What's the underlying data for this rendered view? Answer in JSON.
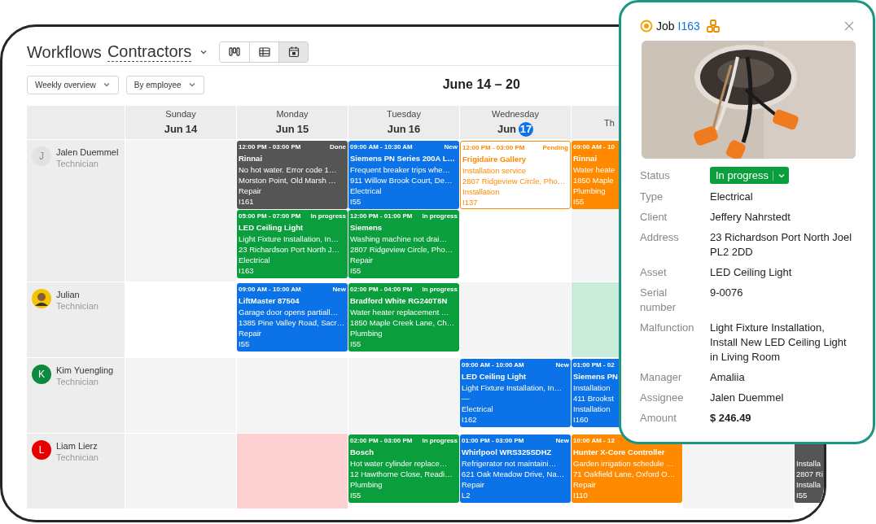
{
  "header": {
    "title": "Workflows",
    "workflow": "Contractors"
  },
  "views": [
    {
      "kind": "board",
      "selected": false
    },
    {
      "kind": "table",
      "selected": false
    },
    {
      "kind": "calendar",
      "selected": true
    }
  ],
  "filters": [
    {
      "label": "Weekly overview"
    },
    {
      "label": "By employee"
    }
  ],
  "period": "June 14 – 20",
  "days": [
    {
      "weekday": "Sunday",
      "month": "Jun",
      "day": "14",
      "today": false
    },
    {
      "weekday": "Monday",
      "month": "Jun",
      "day": "15",
      "today": false
    },
    {
      "weekday": "Tuesday",
      "month": "Jun",
      "day": "16",
      "today": false
    },
    {
      "weekday": "Wednesday",
      "month": "Jun",
      "day": "17",
      "today": true
    },
    {
      "weekday": "Th"
    }
  ],
  "rows": [
    {
      "name": "Jalen Duemmel",
      "role": "Technician",
      "avatar": {
        "kind": "letter",
        "initial": "J",
        "color": "#e2e2e2"
      },
      "cells": [
        {
          "color": "#f3f4f3"
        },
        {
          "events": [
            {
              "kind": "filled",
              "color": "#555555",
              "time": "12:00 PM - 03:00 PM",
              "status": "Done",
              "title": "Rinnai",
              "lines": [
                "No hot water. Error code 1…",
                "Morston Point, Old Marsh …",
                "Repair",
                "I161"
              ]
            },
            {
              "kind": "filled",
              "color": "#0a9e3c",
              "time": "05:00 PM - 07:00 PM",
              "status": "In progress",
              "title": "LED Ceiling Light",
              "lines": [
                "Light Fixture Installation, In…",
                "23 Richardson Port North J…",
                "Electrical",
                "I163"
              ]
            }
          ]
        },
        {
          "events": [
            {
              "kind": "filled",
              "color": "#0b72e7",
              "time": "09:00 AM - 10:30 AM",
              "status": "New",
              "title": "Siemens PN Series 200A L…",
              "lines": [
                "Frequent breaker trips whe…",
                "911 Willow Brook Court, De…",
                "Electrical",
                "I55"
              ]
            },
            {
              "kind": "filled",
              "color": "#0a9e3c",
              "time": "12:00 PM - 01:00 PM",
              "status": "In progress",
              "title": "Siemens",
              "lines": [
                "Washing machine not drai…",
                "2807 Ridgeview Circle, Pho…",
                "Repair",
                "I55"
              ]
            }
          ]
        },
        {
          "events": [
            {
              "kind": "outlined",
              "color": "#ff8a00",
              "time": "12:00 PM - 03:00 PM",
              "status": "Pending",
              "title": "Frigidaire Gallery",
              "lines": [
                "Installation service",
                "2807 Ridgeview Circle, Pho…",
                "Installation",
                "I137"
              ]
            }
          ]
        },
        {
          "color": "#f3f4f3",
          "events": [
            {
              "kind": "filled",
              "color": "#ff8a00",
              "time": "09:00 AM - 10",
              "title": "Rinnai",
              "lines": [
                "Water heate",
                "1850 Maple",
                "Plumbing",
                "I55"
              ]
            }
          ]
        }
      ]
    },
    {
      "name": "Julian",
      "role": "Technician",
      "cells": [
        {},
        {
          "events": [
            {
              "kind": "filled",
              "color": "#0b72e7",
              "time": "09:00 AM - 10:00 AM",
              "status": "New",
              "title": "LiftMaster 87504",
              "lines": [
                "Garage door opens partiall…",
                "1385 Pine Valley Road, Sacr…",
                "Repair",
                "I55"
              ]
            }
          ]
        },
        {
          "events": [
            {
              "kind": "filled",
              "color": "#0a9e3c",
              "time": "02:00 PM - 04:00 PM",
              "status": "In progress",
              "title": "Bradford White RG240T6N",
              "lines": [
                "Water heater replacement …",
                "1850 Maple Creek Lane, Ch…",
                "Plumbing",
                "I55"
              ]
            }
          ]
        },
        {
          "color": "#f3f4f3"
        },
        {
          "color": "#c9ebd9"
        }
      ]
    },
    {
      "name": "Kim Yuengling",
      "role": "Technician",
      "avatar": {
        "kind": "letter",
        "initial": "K",
        "color": "#0d8a3e"
      },
      "cells": [
        {
          "color": "#f3f4f3"
        },
        {
          "color": "#f3f4f3"
        },
        {
          "color": "#f3f4f3"
        },
        {
          "events": [
            {
              "kind": "filled",
              "color": "#0b72e7",
              "time": "09:00 AM - 10:00 AM",
              "status": "New",
              "title": "LED Ceiling Light",
              "lines": [
                "Light Fixture Installation, In…",
                "—",
                "Electrical",
                "I162"
              ]
            }
          ]
        },
        {
          "events": [
            {
              "kind": "filled",
              "color": "#0b72e7",
              "time": "01:00 PM - 02",
              "title": "Siemens PN",
              "lines": [
                "Installation",
                "411 Brookst",
                "Installation",
                "I160"
              ]
            }
          ]
        }
      ]
    },
    {
      "name": "Liam Lierz",
      "role": "Technician",
      "avatar": {
        "kind": "letter",
        "initial": "L",
        "color": "#e60000"
      },
      "cells": [
        {
          "color": "#f3f4f3"
        },
        {
          "color": "#fdd0d2"
        },
        {
          "events": [
            {
              "kind": "filled",
              "color": "#0a9e3c",
              "time": "02:00 PM - 03:00 PM",
              "status": "In progress",
              "title": "Bosch",
              "lines": [
                "Hot water cylinder replace…",
                "12 Hawthorne Close, Readi…",
                "Plumbing",
                "I55"
              ]
            }
          ]
        },
        {
          "events": [
            {
              "kind": "filled",
              "color": "#0b72e7",
              "time": "01:00 PM - 03:00 PM",
              "status": "New",
              "title": "Whirlpool WRS325SDHZ",
              "lines": [
                "Refrigerator not maintaini…",
                "621 Oak Meadow Drive, Na…",
                "Repair",
                "L2"
              ]
            }
          ]
        },
        {
          "events": [
            {
              "kind": "filled",
              "color": "#ff8a00",
              "time": "10:00 AM - 12",
              "title": "Hunter X-Core Controller",
              "lines": [
                "Garden irrigation schedule …",
                "71 Oakfield Lane, Oxford O…",
                "Repair",
                "I110"
              ]
            }
          ]
        },
        {
          "color": "#f3f4f3"
        },
        {
          "events": [
            {
              "kind": "filled",
              "color": "#555555",
              "lines": [
                "Installa",
                "2807 Ri",
                "Installa",
                "I55"
              ]
            }
          ]
        }
      ]
    }
  ],
  "popup": {
    "label": "Job",
    "job_id": "I163",
    "status_label": "Status",
    "status": "In progress",
    "fields": [
      {
        "label": "Type",
        "value": "Electrical",
        "bold": false
      },
      {
        "label": "Client",
        "value": "Jeffery Nahrstedt",
        "bold": false
      },
      {
        "label": "Address",
        "value": "23 Richardson Port North Joel PL2 2DD",
        "bold": false
      },
      {
        "label": "Asset",
        "value": "LED Ceiling Light",
        "bold": false
      },
      {
        "label": "Serial number",
        "value": "9-0076",
        "bold": false
      },
      {
        "label": "Malfunction",
        "value": "Light Fixture Installation, Install New LED Ceiling Light in Living Room",
        "bold": false
      },
      {
        "label": "Manager",
        "value": "Amaliia",
        "bold": false
      },
      {
        "label": "Assignee",
        "value": "Jalen Duemmel",
        "bold": false
      },
      {
        "label": "Amount",
        "value": "$ 246.49",
        "bold": true
      }
    ]
  }
}
